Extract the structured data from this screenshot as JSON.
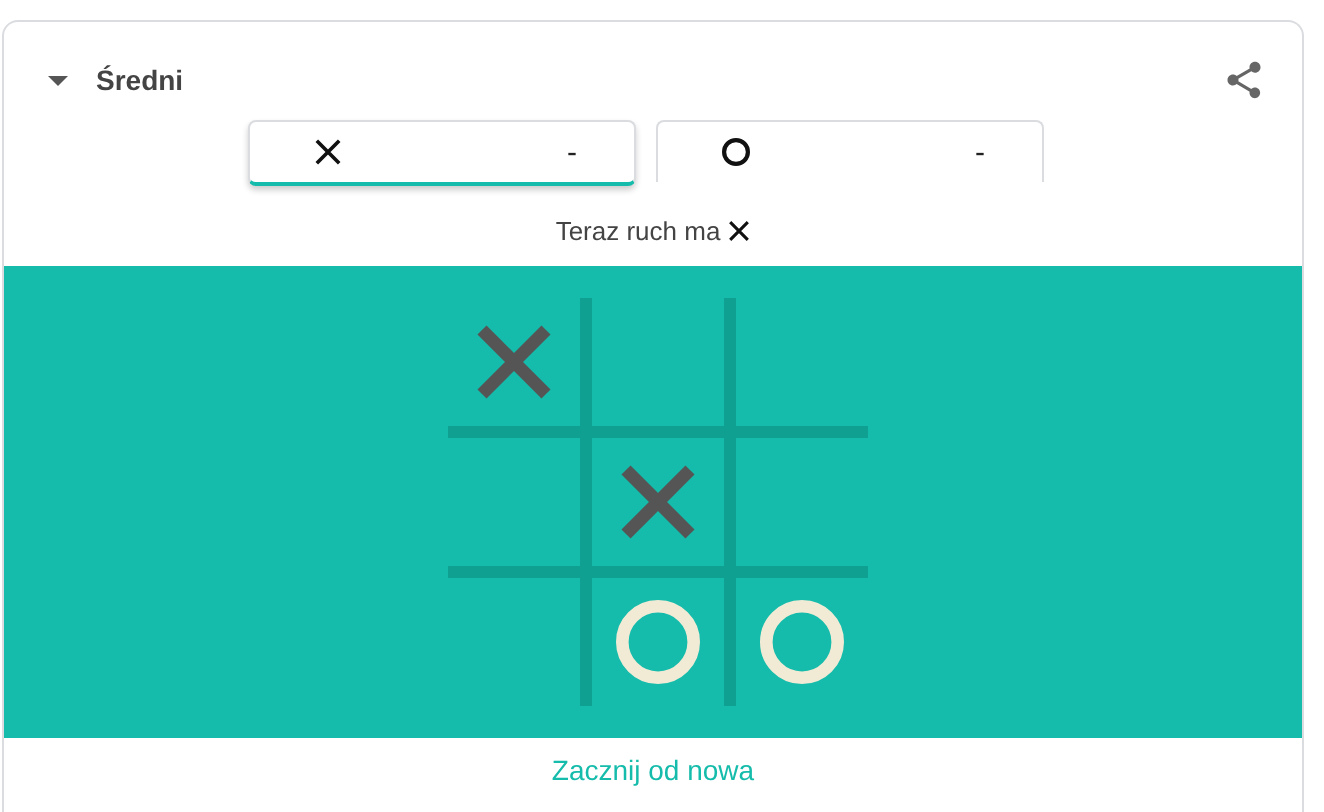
{
  "header": {
    "title": "Średni",
    "expanded": true
  },
  "players": [
    {
      "kind": "x",
      "score": "-",
      "selected": true
    },
    {
      "kind": "o",
      "score": "-",
      "selected": false
    }
  ],
  "status": {
    "text": "Teraz ruch ma",
    "kind": "x"
  },
  "board": [
    {
      "kind": "x"
    },
    {
      "kind": "empty"
    },
    {
      "kind": "empty"
    },
    {
      "kind": "empty"
    },
    {
      "kind": "x"
    },
    {
      "kind": "empty"
    },
    {
      "kind": "empty"
    },
    {
      "kind": "o"
    },
    {
      "kind": "o"
    }
  ],
  "restart_button": "Zacznij od nowa"
}
